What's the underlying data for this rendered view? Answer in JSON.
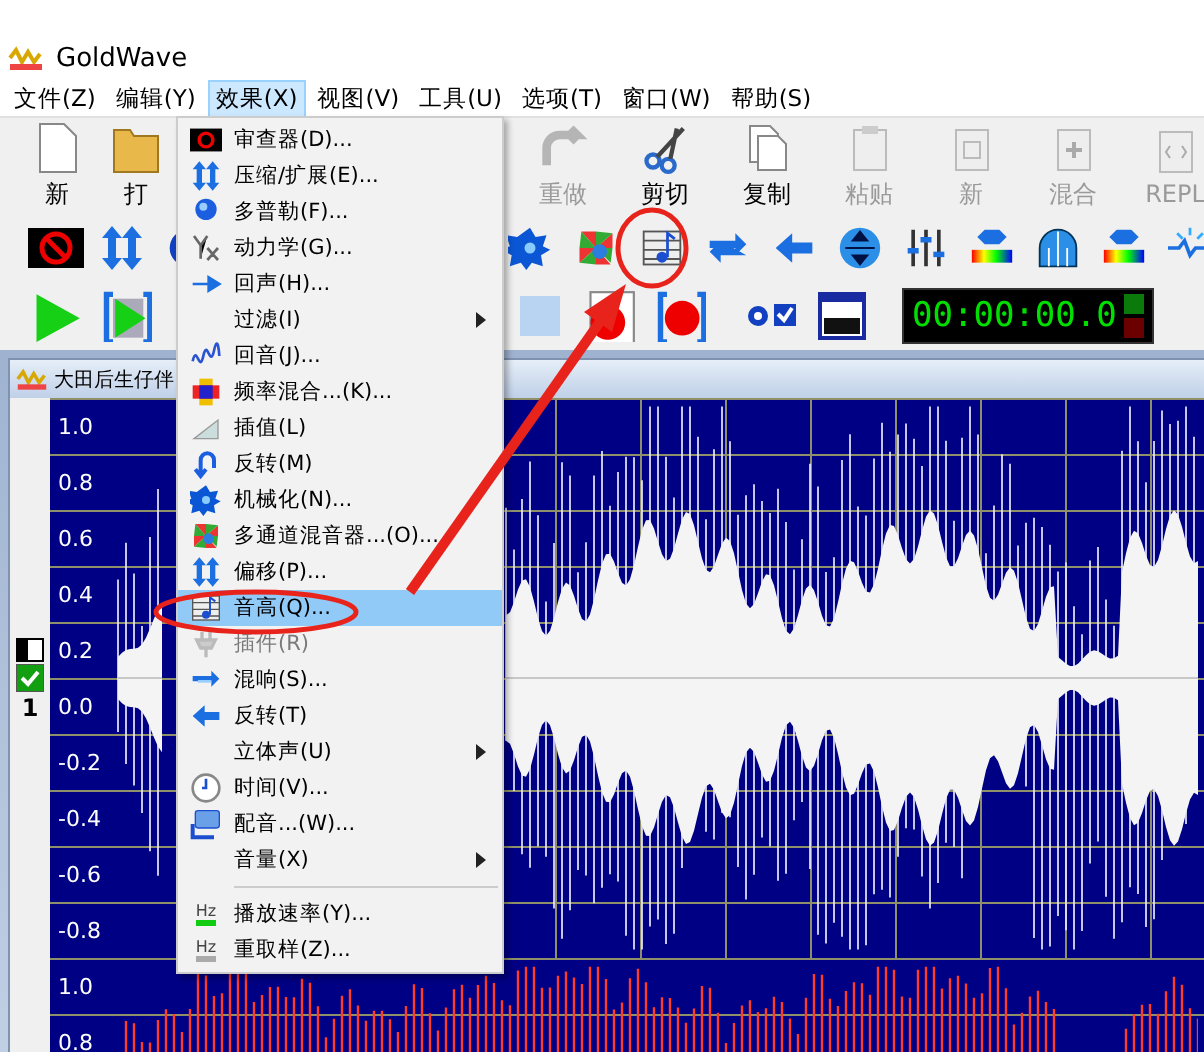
{
  "app": {
    "title": "GoldWave"
  },
  "menu_bar": [
    {
      "label": "文件(Z)",
      "selected": false
    },
    {
      "label": "编辑(Y)",
      "selected": false
    },
    {
      "label": "效果(X)",
      "selected": true
    },
    {
      "label": "视图(V)",
      "selected": false
    },
    {
      "label": "工具(U)",
      "selected": false
    },
    {
      "label": "选项(T)",
      "selected": false
    },
    {
      "label": "窗口(W)",
      "selected": false
    },
    {
      "label": "帮助(S)",
      "selected": false
    }
  ],
  "toolbar_main": [
    {
      "label": "新",
      "disabled": false
    },
    {
      "label": "打"
    },
    {
      "label": "重做",
      "disabled": true
    },
    {
      "label": "剪切",
      "disabled": false
    },
    {
      "label": "复制",
      "disabled": false
    },
    {
      "label": "粘贴",
      "disabled": true
    },
    {
      "label": "新",
      "disabled": true
    },
    {
      "label": "混合",
      "disabled": true
    },
    {
      "label": "REPL",
      "disabled": true
    }
  ],
  "timer": "00:00:00.0",
  "document": {
    "title": "大田后生仔伴",
    "channel_toggle": {
      "label": "1",
      "checked": true
    },
    "tracks": [
      {
        "axis_labels": [
          "1.0",
          "0.8",
          "0.6",
          "0.4",
          "0.2",
          "0.0",
          "-0.2",
          "-0.4",
          "-0.6",
          "-0.8"
        ]
      },
      {
        "axis_labels": [
          "1.0",
          "0.8"
        ]
      }
    ]
  },
  "effects_menu": {
    "items": [
      {
        "kind": "item",
        "label": "审查器(D)...",
        "selected": false,
        "disabled": false
      },
      {
        "kind": "item",
        "label": "压缩/扩展(E)...",
        "selected": false,
        "disabled": false
      },
      {
        "kind": "item",
        "label": "多普勒(F)...",
        "selected": false,
        "disabled": false
      },
      {
        "kind": "item",
        "label": "动力学(G)...",
        "selected": false,
        "disabled": false
      },
      {
        "kind": "item",
        "label": "回声(H)...",
        "selected": false,
        "disabled": false
      },
      {
        "kind": "submenu",
        "label": "过滤(I)",
        "selected": false,
        "disabled": false
      },
      {
        "kind": "item",
        "label": "回音(J)...",
        "selected": false,
        "disabled": false
      },
      {
        "kind": "item",
        "label": "频率混合...(K)...",
        "selected": false,
        "disabled": false
      },
      {
        "kind": "item",
        "label": "插值(L)",
        "selected": false,
        "disabled": false
      },
      {
        "kind": "item",
        "label": "反转(M)",
        "selected": false,
        "disabled": false
      },
      {
        "kind": "item",
        "label": "机械化(N)...",
        "selected": false,
        "disabled": false
      },
      {
        "kind": "item",
        "label": "多通道混音器...(O)...",
        "selected": false,
        "disabled": false
      },
      {
        "kind": "item",
        "label": "偏移(P)...",
        "selected": false,
        "disabled": false
      },
      {
        "kind": "item",
        "label": "音高(Q)...",
        "selected": true,
        "disabled": false
      },
      {
        "kind": "item",
        "label": "插件(R)",
        "selected": false,
        "disabled": true
      },
      {
        "kind": "item",
        "label": "混响(S)...",
        "selected": false,
        "disabled": false
      },
      {
        "kind": "item",
        "label": "反转(T)",
        "selected": false,
        "disabled": false
      },
      {
        "kind": "submenu",
        "label": "立体声(U)",
        "selected": false,
        "disabled": false
      },
      {
        "kind": "item",
        "label": "时间(V)...",
        "selected": false,
        "disabled": false
      },
      {
        "kind": "item",
        "label": "配音...(W)...",
        "selected": false,
        "disabled": false
      },
      {
        "kind": "submenu",
        "label": "音量(X)",
        "selected": false,
        "disabled": false
      },
      {
        "kind": "separator"
      },
      {
        "kind": "item",
        "label": "播放速率(Y)...",
        "icon_text": "Hz",
        "selected": false,
        "disabled": false
      },
      {
        "kind": "item",
        "label": "重取样(Z)...",
        "icon_text": "Hz",
        "selected": false,
        "disabled": false
      }
    ]
  }
}
